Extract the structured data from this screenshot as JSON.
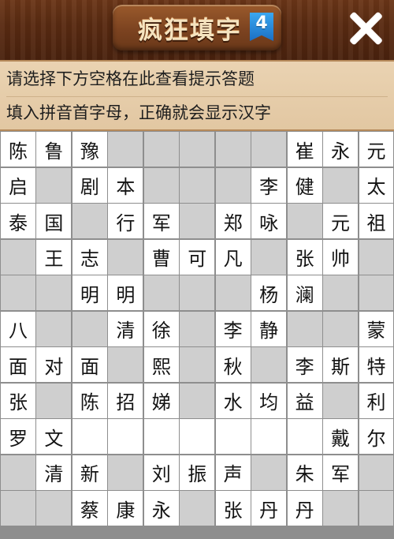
{
  "header": {
    "title": "疯狂填字",
    "level_badge": "4",
    "close_icon": "close-icon"
  },
  "hints": {
    "line1": "请选择下方空格在此查看提示答题",
    "line2": "填入拼音首字母，正确就会显示汉字"
  },
  "colors": {
    "wood_dark": "#4a220e",
    "plaque": "#7c4320",
    "hint_bg": "#ead3b2",
    "cell_filled": "#ffffff",
    "cell_empty": "#cfcfcf",
    "grid_line": "#8e8e8e",
    "badge_blue": "#2a8ee0"
  },
  "grid": {
    "rows": [
      [
        "陈",
        "鲁",
        "豫",
        "",
        "",
        "",
        "",
        "",
        "崔",
        "永",
        "元"
      ],
      [
        "启",
        "",
        "剧",
        "本",
        "",
        "",
        "",
        "李",
        "健",
        "",
        "太"
      ],
      [
        "泰",
        "国",
        "",
        "行",
        "军",
        "",
        "郑",
        "咏",
        "",
        "元",
        "祖"
      ],
      [
        "",
        "王",
        "志",
        "",
        "曹",
        "可",
        "凡",
        "",
        "张",
        "帅",
        ""
      ],
      [
        "",
        "",
        "明",
        "明",
        "",
        "",
        "",
        "杨",
        "澜",
        "",
        ""
      ],
      [
        "八",
        "",
        "",
        "清",
        "徐",
        "",
        "李",
        "静",
        "",
        "",
        "蒙"
      ],
      [
        "面",
        "对",
        "面",
        "",
        "熙",
        "",
        "秋",
        "",
        "李",
        "斯",
        "特"
      ],
      [
        "张",
        "",
        "陈",
        "招",
        "娣",
        "",
        "水",
        "均",
        "益",
        "",
        "利"
      ],
      [
        "罗",
        "文",
        "",
        "",
        "",
        "",
        "",
        "",
        "",
        "戴",
        "尔"
      ],
      [
        "",
        "清",
        "新",
        "",
        "刘",
        "振",
        "声",
        "",
        "朱",
        "军",
        ""
      ],
      [
        "",
        "",
        "蔡",
        "康",
        "永",
        "",
        "张",
        "丹",
        "丹",
        "",
        ""
      ]
    ],
    "active": [
      [
        1,
        1,
        1,
        0,
        0,
        0,
        0,
        0,
        1,
        1,
        1
      ],
      [
        1,
        0,
        1,
        1,
        0,
        0,
        0,
        1,
        1,
        0,
        1
      ],
      [
        1,
        1,
        0,
        1,
        1,
        0,
        1,
        1,
        0,
        1,
        1
      ],
      [
        0,
        1,
        1,
        0,
        1,
        1,
        1,
        0,
        1,
        1,
        0
      ],
      [
        0,
        0,
        1,
        1,
        0,
        0,
        0,
        1,
        1,
        0,
        0
      ],
      [
        1,
        0,
        0,
        1,
        1,
        0,
        1,
        1,
        0,
        0,
        1
      ],
      [
        1,
        1,
        1,
        0,
        1,
        0,
        1,
        0,
        1,
        1,
        1
      ],
      [
        1,
        0,
        1,
        1,
        1,
        0,
        1,
        1,
        1,
        0,
        1
      ],
      [
        1,
        1,
        1,
        1,
        1,
        1,
        1,
        1,
        1,
        1,
        1
      ],
      [
        0,
        1,
        1,
        0,
        1,
        1,
        1,
        0,
        1,
        1,
        0
      ],
      [
        0,
        0,
        1,
        1,
        1,
        0,
        1,
        1,
        1,
        0,
        0
      ]
    ]
  }
}
